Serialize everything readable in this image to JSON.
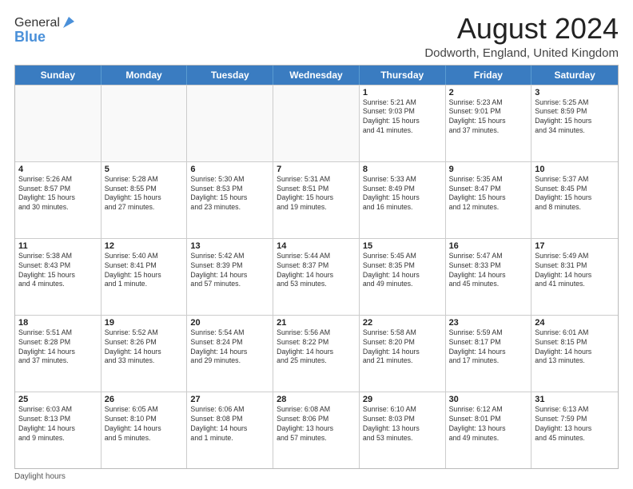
{
  "header": {
    "logo_general": "General",
    "logo_blue": "Blue",
    "month_year": "August 2024",
    "location": "Dodworth, England, United Kingdom"
  },
  "days_of_week": [
    "Sunday",
    "Monday",
    "Tuesday",
    "Wednesday",
    "Thursday",
    "Friday",
    "Saturday"
  ],
  "weeks": [
    [
      {
        "day": "",
        "text": "",
        "shaded": true
      },
      {
        "day": "",
        "text": "",
        "shaded": true
      },
      {
        "day": "",
        "text": "",
        "shaded": true
      },
      {
        "day": "",
        "text": "",
        "shaded": true
      },
      {
        "day": "1",
        "text": "Sunrise: 5:21 AM\nSunset: 9:03 PM\nDaylight: 15 hours\nand 41 minutes.",
        "shaded": false
      },
      {
        "day": "2",
        "text": "Sunrise: 5:23 AM\nSunset: 9:01 PM\nDaylight: 15 hours\nand 37 minutes.",
        "shaded": false
      },
      {
        "day": "3",
        "text": "Sunrise: 5:25 AM\nSunset: 8:59 PM\nDaylight: 15 hours\nand 34 minutes.",
        "shaded": false
      }
    ],
    [
      {
        "day": "4",
        "text": "Sunrise: 5:26 AM\nSunset: 8:57 PM\nDaylight: 15 hours\nand 30 minutes.",
        "shaded": false
      },
      {
        "day": "5",
        "text": "Sunrise: 5:28 AM\nSunset: 8:55 PM\nDaylight: 15 hours\nand 27 minutes.",
        "shaded": false
      },
      {
        "day": "6",
        "text": "Sunrise: 5:30 AM\nSunset: 8:53 PM\nDaylight: 15 hours\nand 23 minutes.",
        "shaded": false
      },
      {
        "day": "7",
        "text": "Sunrise: 5:31 AM\nSunset: 8:51 PM\nDaylight: 15 hours\nand 19 minutes.",
        "shaded": false
      },
      {
        "day": "8",
        "text": "Sunrise: 5:33 AM\nSunset: 8:49 PM\nDaylight: 15 hours\nand 16 minutes.",
        "shaded": false
      },
      {
        "day": "9",
        "text": "Sunrise: 5:35 AM\nSunset: 8:47 PM\nDaylight: 15 hours\nand 12 minutes.",
        "shaded": false
      },
      {
        "day": "10",
        "text": "Sunrise: 5:37 AM\nSunset: 8:45 PM\nDaylight: 15 hours\nand 8 minutes.",
        "shaded": false
      }
    ],
    [
      {
        "day": "11",
        "text": "Sunrise: 5:38 AM\nSunset: 8:43 PM\nDaylight: 15 hours\nand 4 minutes.",
        "shaded": false
      },
      {
        "day": "12",
        "text": "Sunrise: 5:40 AM\nSunset: 8:41 PM\nDaylight: 15 hours\nand 1 minute.",
        "shaded": false
      },
      {
        "day": "13",
        "text": "Sunrise: 5:42 AM\nSunset: 8:39 PM\nDaylight: 14 hours\nand 57 minutes.",
        "shaded": false
      },
      {
        "day": "14",
        "text": "Sunrise: 5:44 AM\nSunset: 8:37 PM\nDaylight: 14 hours\nand 53 minutes.",
        "shaded": false
      },
      {
        "day": "15",
        "text": "Sunrise: 5:45 AM\nSunset: 8:35 PM\nDaylight: 14 hours\nand 49 minutes.",
        "shaded": false
      },
      {
        "day": "16",
        "text": "Sunrise: 5:47 AM\nSunset: 8:33 PM\nDaylight: 14 hours\nand 45 minutes.",
        "shaded": false
      },
      {
        "day": "17",
        "text": "Sunrise: 5:49 AM\nSunset: 8:31 PM\nDaylight: 14 hours\nand 41 minutes.",
        "shaded": false
      }
    ],
    [
      {
        "day": "18",
        "text": "Sunrise: 5:51 AM\nSunset: 8:28 PM\nDaylight: 14 hours\nand 37 minutes.",
        "shaded": false
      },
      {
        "day": "19",
        "text": "Sunrise: 5:52 AM\nSunset: 8:26 PM\nDaylight: 14 hours\nand 33 minutes.",
        "shaded": false
      },
      {
        "day": "20",
        "text": "Sunrise: 5:54 AM\nSunset: 8:24 PM\nDaylight: 14 hours\nand 29 minutes.",
        "shaded": false
      },
      {
        "day": "21",
        "text": "Sunrise: 5:56 AM\nSunset: 8:22 PM\nDaylight: 14 hours\nand 25 minutes.",
        "shaded": false
      },
      {
        "day": "22",
        "text": "Sunrise: 5:58 AM\nSunset: 8:20 PM\nDaylight: 14 hours\nand 21 minutes.",
        "shaded": false
      },
      {
        "day": "23",
        "text": "Sunrise: 5:59 AM\nSunset: 8:17 PM\nDaylight: 14 hours\nand 17 minutes.",
        "shaded": false
      },
      {
        "day": "24",
        "text": "Sunrise: 6:01 AM\nSunset: 8:15 PM\nDaylight: 14 hours\nand 13 minutes.",
        "shaded": false
      }
    ],
    [
      {
        "day": "25",
        "text": "Sunrise: 6:03 AM\nSunset: 8:13 PM\nDaylight: 14 hours\nand 9 minutes.",
        "shaded": false
      },
      {
        "day": "26",
        "text": "Sunrise: 6:05 AM\nSunset: 8:10 PM\nDaylight: 14 hours\nand 5 minutes.",
        "shaded": false
      },
      {
        "day": "27",
        "text": "Sunrise: 6:06 AM\nSunset: 8:08 PM\nDaylight: 14 hours\nand 1 minute.",
        "shaded": false
      },
      {
        "day": "28",
        "text": "Sunrise: 6:08 AM\nSunset: 8:06 PM\nDaylight: 13 hours\nand 57 minutes.",
        "shaded": false
      },
      {
        "day": "29",
        "text": "Sunrise: 6:10 AM\nSunset: 8:03 PM\nDaylight: 13 hours\nand 53 minutes.",
        "shaded": false
      },
      {
        "day": "30",
        "text": "Sunrise: 6:12 AM\nSunset: 8:01 PM\nDaylight: 13 hours\nand 49 minutes.",
        "shaded": false
      },
      {
        "day": "31",
        "text": "Sunrise: 6:13 AM\nSunset: 7:59 PM\nDaylight: 13 hours\nand 45 minutes.",
        "shaded": false
      }
    ]
  ],
  "footer": {
    "daylight_label": "Daylight hours"
  }
}
